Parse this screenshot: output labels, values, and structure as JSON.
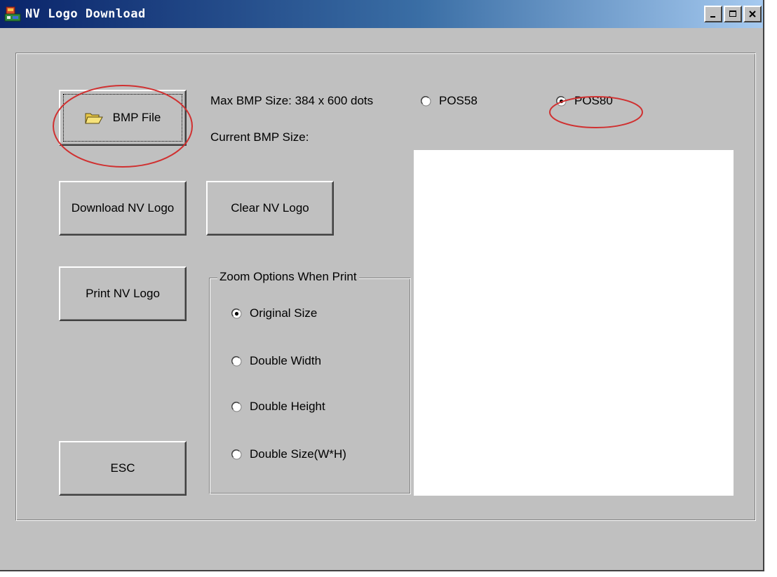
{
  "window": {
    "title": "NV Logo Download"
  },
  "buttons": {
    "bmp_file": "BMP File",
    "download": "Download NV Logo",
    "clear": "Clear NV Logo",
    "print": "Print NV Logo",
    "esc": "ESC"
  },
  "info": {
    "max_size": "Max BMP Size: 384 x 600 dots",
    "current_size": "Current BMP Size:"
  },
  "printer_model": {
    "options": [
      "POS58",
      "POS80"
    ],
    "selected": "POS80"
  },
  "zoom": {
    "legend": "Zoom Options When Print",
    "options": [
      "Original Size",
      "Double Width",
      "Double Height",
      "Double Size(W*H)"
    ],
    "selected": "Original Size"
  },
  "colors": {
    "face": "#c0c0c0",
    "title_start": "#0a246a",
    "title_end": "#a6caf0",
    "annotation": "#d03030"
  },
  "icons": [
    "app-icon",
    "folder-open-icon",
    "minimize-icon",
    "maximize-icon",
    "close-icon"
  ]
}
